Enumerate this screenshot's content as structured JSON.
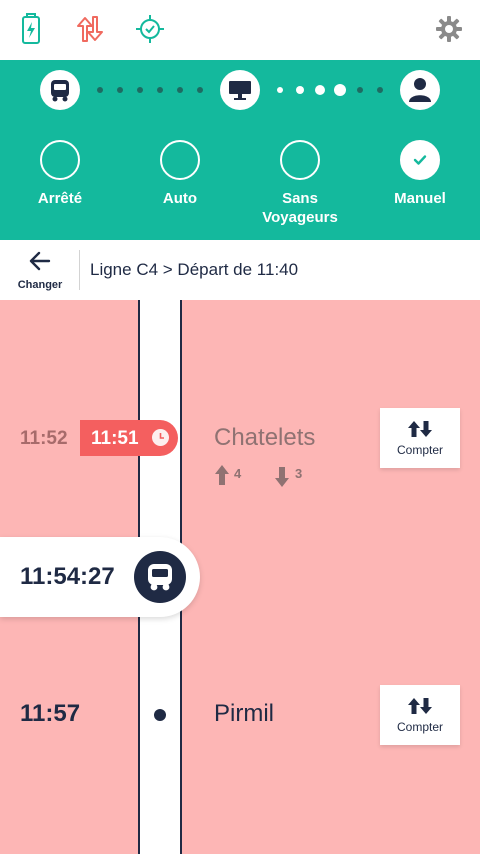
{
  "status_bar": {
    "icons": [
      "battery-charging-icon",
      "sync-arrows-icon",
      "gps-target-icon",
      "settings-gear-icon"
    ],
    "colors": {
      "teal": "#14b99d",
      "alert": "#f06a5f",
      "gray": "#8a8a8a"
    }
  },
  "modes": {
    "stages": [
      "bus-icon",
      "terminal-icon",
      "driver-icon"
    ],
    "options": [
      {
        "label": "Arrêté",
        "selected": false
      },
      {
        "label": "Auto",
        "selected": false
      },
      {
        "label": "Sans\nVoyageurs",
        "selected": false
      },
      {
        "label": "Manuel",
        "selected": true
      }
    ]
  },
  "route": {
    "back_label": "Changer",
    "title": "Ligne C4 > Départ de 11:40"
  },
  "timeline": {
    "stops": [
      {
        "scheduled": "11:52",
        "realtime": "11:51",
        "name": "Chatelets",
        "boarding": "4",
        "alighting": "3",
        "count_button": "Compter"
      },
      {
        "scheduled": "11:57",
        "name": "Pirmil",
        "count_button": "Compter"
      }
    ],
    "current_time": "11:54:27"
  },
  "colors": {
    "accent": "#14b99d",
    "timeline_bg": "#fdb6b5",
    "late_badge": "#f45f5f",
    "text_dark": "#1f2a44"
  }
}
